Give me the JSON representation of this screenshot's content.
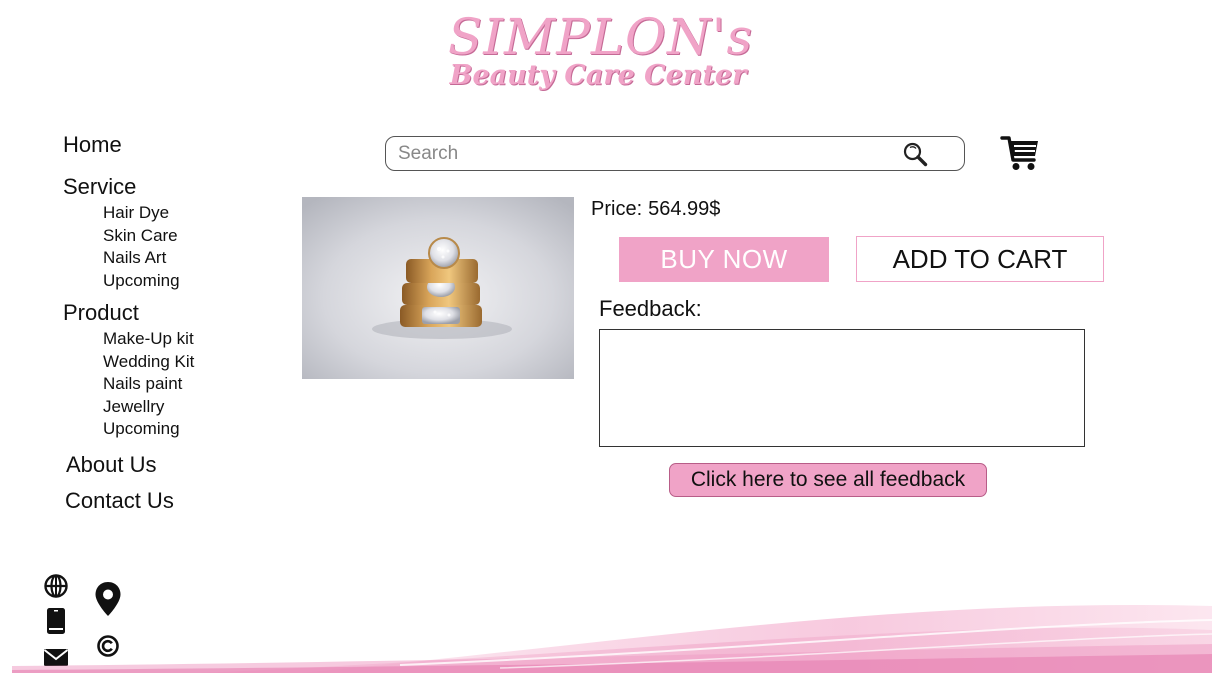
{
  "logo": {
    "brand": "SIMPLON's",
    "tagline": "Beauty Care Center"
  },
  "sidebar": {
    "home": "Home",
    "service": {
      "label": "Service",
      "items": [
        "Hair Dye",
        "Skin Care",
        "Nails Art",
        "Upcoming"
      ]
    },
    "product": {
      "label": "Product",
      "items": [
        "Make-Up kit",
        "Wedding Kit",
        "Nails paint",
        "Jewellry",
        "Upcoming"
      ]
    },
    "about": "About Us",
    "contact": "Contact Us"
  },
  "search": {
    "placeholder": "Search",
    "value": ""
  },
  "product": {
    "price_label": "Price:",
    "price_value": "564.99$",
    "buy_label": "BUY NOW",
    "cart_label": "ADD TO CART",
    "feedback_label": "Feedback:",
    "feedback_value": "",
    "all_feedback_label": "Click here to see all feedback"
  },
  "colors": {
    "accent": "#f0a3c7",
    "accent_dark": "#b85d88"
  },
  "icons": {
    "search": "search-icon",
    "cart": "cart-icon",
    "globe": "globe-icon",
    "location": "location-pin-icon",
    "phone": "phone-icon",
    "copyright": "copyright-icon",
    "mail": "mail-icon"
  }
}
